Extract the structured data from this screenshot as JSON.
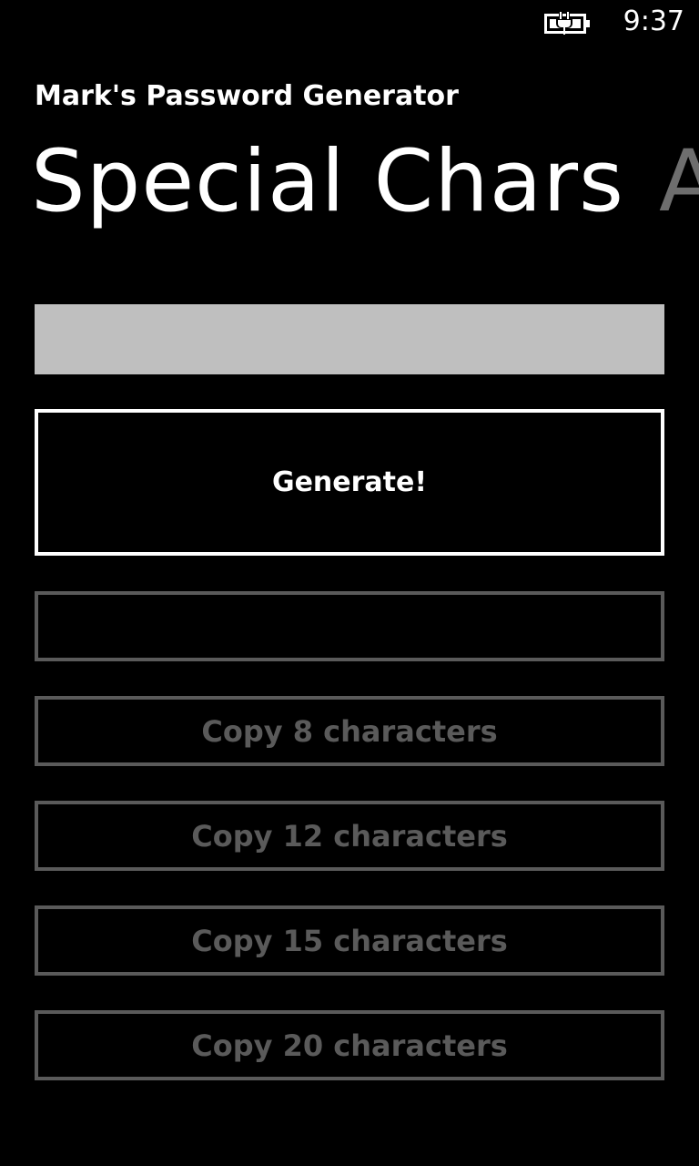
{
  "status_bar": {
    "time": "9:37",
    "battery_icon": "battery-charging-icon"
  },
  "app": {
    "title": "Mark's Password Generator"
  },
  "pivot": {
    "active": "Special Chars",
    "next_partial": "A"
  },
  "password": {
    "value": ""
  },
  "buttons": {
    "generate": "Generate!",
    "blank": "",
    "copy_8": "Copy 8 characters",
    "copy_12": "Copy 12 characters",
    "copy_15": "Copy 15 characters",
    "copy_20": "Copy 20 characters"
  },
  "colors": {
    "background": "#000000",
    "text": "#ffffff",
    "input_background": "#bfbfbf",
    "disabled": "#5a5a5a",
    "pivot_inactive": "#6e6e6e"
  }
}
